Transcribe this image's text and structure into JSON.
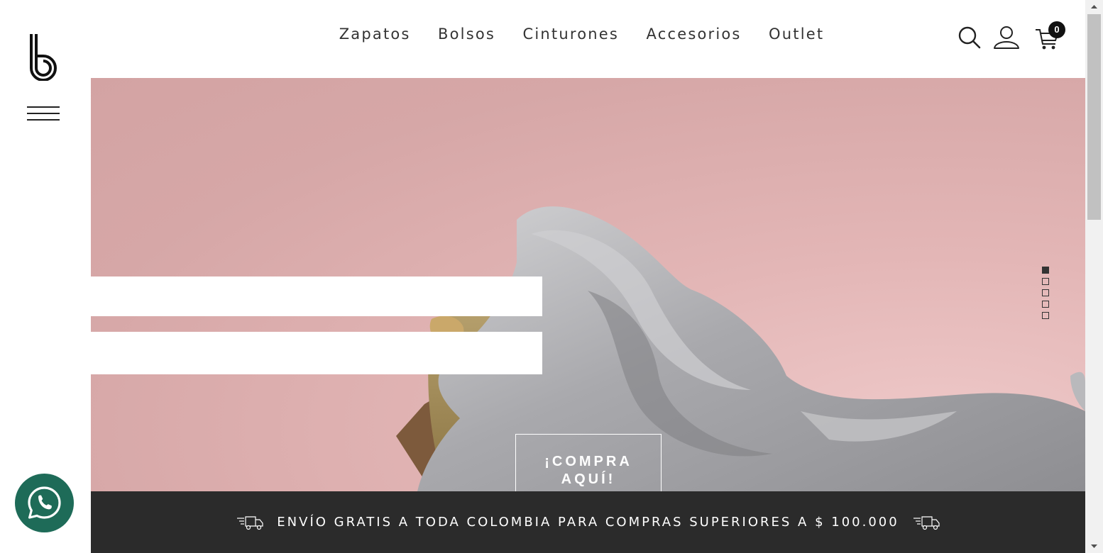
{
  "nav": {
    "items": [
      {
        "label": "Zapatos"
      },
      {
        "label": "Bolsos"
      },
      {
        "label": "Cinturones"
      },
      {
        "label": "Accesorios"
      },
      {
        "label": "Outlet"
      }
    ]
  },
  "header_icons": {
    "search": "search-icon",
    "account": "user-icon",
    "cart": "cart-icon",
    "cart_count": "0"
  },
  "hero": {
    "cta_line1": "¡COMPRA",
    "cta_line2": "AQUÍ!",
    "slider": {
      "count": 5,
      "active": 1
    }
  },
  "banner": {
    "text": "ENVÍO GRATIS A TODA COLOMBIA PARA COMPRAS SUPERIORES A $ 100.000",
    "icon": "delivery-truck-icon"
  },
  "whatsapp": {
    "icon": "whatsapp-icon"
  },
  "colors": {
    "hero_pink": "#d6a7a7",
    "banner_bg": "#2b2b2b",
    "whatsapp_green": "#1e6b58"
  }
}
